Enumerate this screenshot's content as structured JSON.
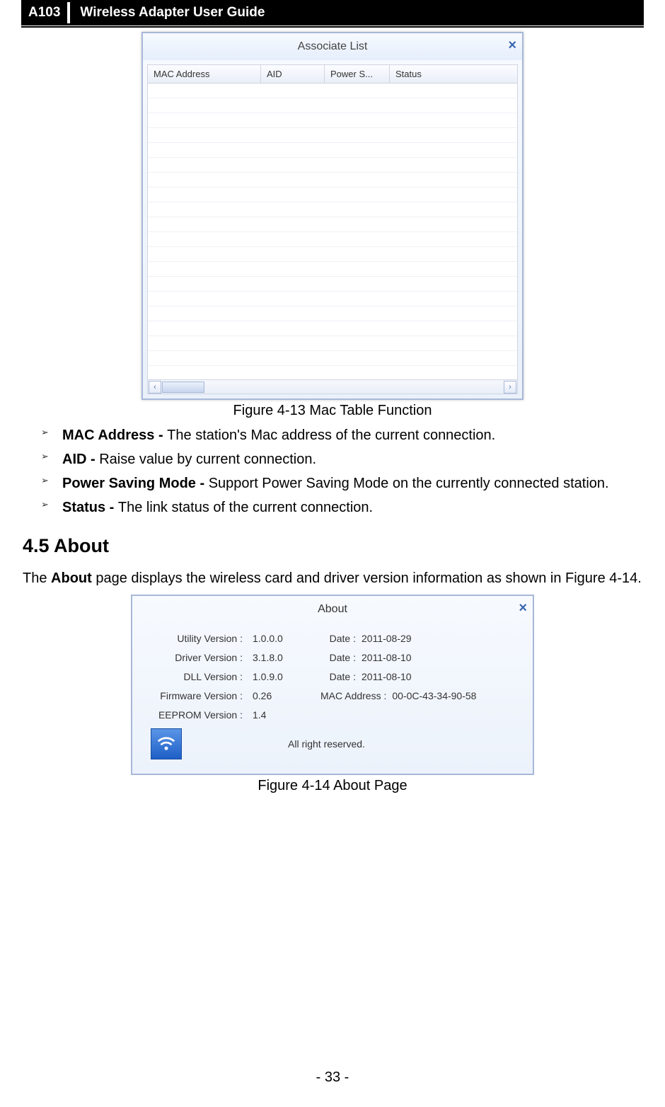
{
  "header": {
    "brand": "A103",
    "title": "Wireless Adapter User Guide"
  },
  "associate": {
    "win_title": "Associate List",
    "cols": [
      "MAC Address",
      "AID",
      "Power S...",
      "Status"
    ]
  },
  "fig1_cap": "Figure 4-13 Mac Table Function",
  "bullets": [
    {
      "b": "MAC Address - ",
      "t": "The station's Mac address of the current connection."
    },
    {
      "b": "AID - ",
      "t": "Raise value by current connection."
    },
    {
      "b": "Power Saving Mode - ",
      "t": "Support Power Saving Mode on the currently connected station."
    },
    {
      "b": "Status - ",
      "t": "The link status of the current connection."
    }
  ],
  "section": "4.5  About",
  "para": {
    "pre": "The ",
    "bold": "About",
    "post": " page displays the wireless card and driver version information as shown in Figure 4-14."
  },
  "about": {
    "title": "About",
    "rows": [
      {
        "lab1": "Utility Version :",
        "val1": "1.0.0.0",
        "lab2": "Date :",
        "val2": "2011-08-29"
      },
      {
        "lab1": "Driver Version :",
        "val1": "3.1.8.0",
        "lab2": "Date :",
        "val2": "2011-08-10"
      },
      {
        "lab1": "DLL Version :",
        "val1": "1.0.9.0",
        "lab2": "Date :",
        "val2": "2011-08-10"
      }
    ],
    "fw": {
      "lab": "Firmware Version :",
      "val": "0.26",
      "maclab": "MAC Address :",
      "macval": "00-0C-43-34-90-58"
    },
    "eep": {
      "lab": "EEPROM Version :",
      "val": "1.4"
    },
    "reserved": "All right reserved."
  },
  "fig2_cap": "Figure 4-14 About Page",
  "page_no": "- 33 -"
}
